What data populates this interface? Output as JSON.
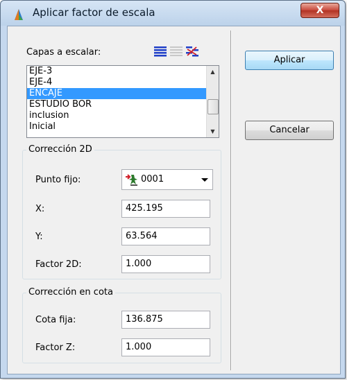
{
  "window": {
    "title": "Aplicar factor de escala",
    "close_label": "X"
  },
  "layers": {
    "label": "Capas a escalar:",
    "items": [
      "EJE-3",
      "EJE-4",
      "ENCAJE",
      "ESTUDIO BOR",
      "inclusion",
      "Inicial"
    ],
    "selected": "ENCAJE"
  },
  "correction_2d": {
    "title": "Corrección 2D",
    "fixed_point_label": "Punto fijo:",
    "fixed_point_value": "0001",
    "x_label": "X:",
    "x_value": "425.195",
    "y_label": "Y:",
    "y_value": "63.564",
    "factor_label": "Factor 2D:",
    "factor_value": "1.000"
  },
  "correction_z": {
    "title": "Corrección en cota",
    "fixed_elev_label": "Cota fija:",
    "fixed_elev_value": "136.875",
    "factor_label": "Factor Z:",
    "factor_value": "1.000"
  },
  "buttons": {
    "apply": "Aplicar",
    "cancel": "Cancelar"
  },
  "icons": {
    "app": "app-logo-icon",
    "select_all": "select-all-icon",
    "select_none": "select-none-icon",
    "invert": "invert-selection-icon",
    "point": "survey-point-icon"
  },
  "colors": {
    "selection": "#3399ff",
    "title_bar": "#c5d8ee",
    "close_button": "#c7473a"
  }
}
